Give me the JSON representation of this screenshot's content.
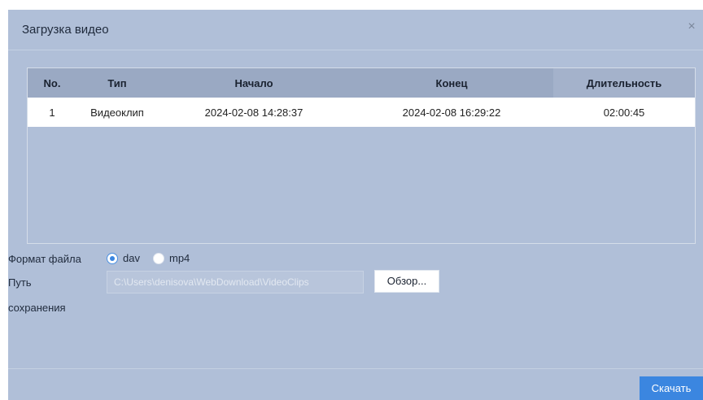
{
  "dialog": {
    "title": "Загрузка видео",
    "close_icon": "×"
  },
  "table": {
    "headers": [
      "No.",
      "Тип",
      "Начало",
      "Конец",
      "Длительность"
    ],
    "rows": [
      [
        "1",
        "Видеоклип",
        "2024-02-08 14:28:37",
        "2024-02-08 16:29:22",
        "02:00:45"
      ]
    ]
  },
  "format": {
    "label": "Формат файла",
    "options": [
      {
        "label": "dav",
        "checked": true
      },
      {
        "label": "mp4",
        "checked": false
      }
    ]
  },
  "save_path": {
    "label_line1": "Путь",
    "label_line2": "сохранения",
    "value": "C:\\Users\\denisova\\WebDownload\\VideoClips",
    "browse_label": "Обзор..."
  },
  "footer": {
    "download_label": "Скачать"
  },
  "colors": {
    "accent": "#3b86e0",
    "dialog_bg": "#b0bfd8",
    "header_bg": "#9aa9c3"
  }
}
